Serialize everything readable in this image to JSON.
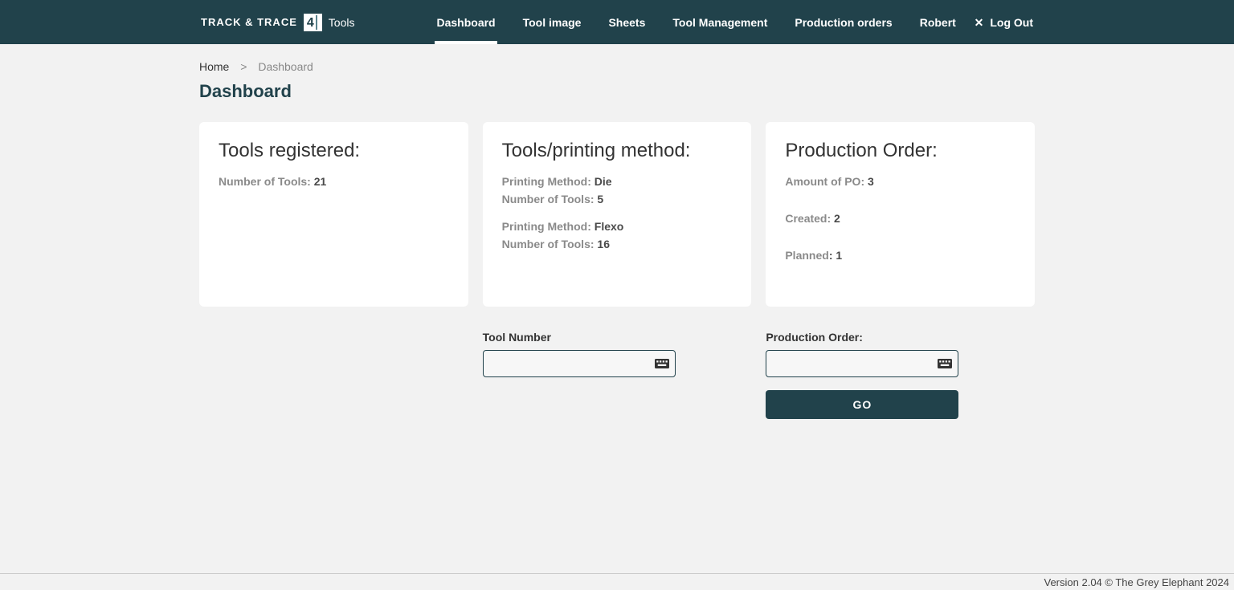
{
  "brand": {
    "left": "TRACK & TRACE",
    "mid": "4",
    "right": "Tools"
  },
  "nav": {
    "items": [
      "Dashboard",
      "Tool image",
      "Sheets",
      "Tool Management",
      "Production orders",
      "Robert"
    ],
    "activeIndex": 0
  },
  "logout": "Log Out",
  "breadcrumb": {
    "home": "Home",
    "sep": ">",
    "current": "Dashboard"
  },
  "pageTitle": "Dashboard",
  "card1": {
    "title": "Tools registered:",
    "labelNumTools": "Number of Tools: ",
    "numTools": "21"
  },
  "card2": {
    "title": "Tools/printing method:",
    "labelPrintMethod": "Printing Method: ",
    "labelNumTools": "Number of Tools: ",
    "methods": [
      {
        "method": "Die",
        "count": "5"
      },
      {
        "method": "Flexo",
        "count": "16"
      }
    ]
  },
  "card3": {
    "title": "Production Order:",
    "labelAmount": "Amount of PO: ",
    "amount": "3",
    "labelCreated": "Created: ",
    "created": "2",
    "labelPlanned": "Planned",
    "planned": "1"
  },
  "inputs": {
    "toolNumberLabel": "Tool Number",
    "toolNumberValue": "",
    "poLabel": "Production Order:",
    "poValue": "",
    "goLabel": "GO"
  },
  "footer": "Version 2.04 © The Grey Elephant 2024"
}
